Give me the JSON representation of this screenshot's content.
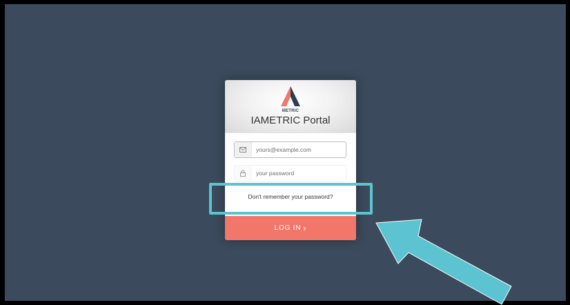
{
  "portal": {
    "logo_text": "METRIC",
    "title": "IAMETRIC Portal"
  },
  "form": {
    "email_placeholder": "yours@example.com",
    "password_placeholder": "your password",
    "forgot_password": "Don't remember your password?",
    "login_label": "LOG IN",
    "login_chevron": "›"
  },
  "icons": {
    "email": "envelope-icon",
    "password": "lock-icon",
    "submit": "chevron-right-icon"
  },
  "colors": {
    "background": "#3b4a5c",
    "button": "#f2776a",
    "highlight": "#5bc4d0",
    "logo_dark": "#2d3e50",
    "logo_accent": "#f2776a"
  }
}
